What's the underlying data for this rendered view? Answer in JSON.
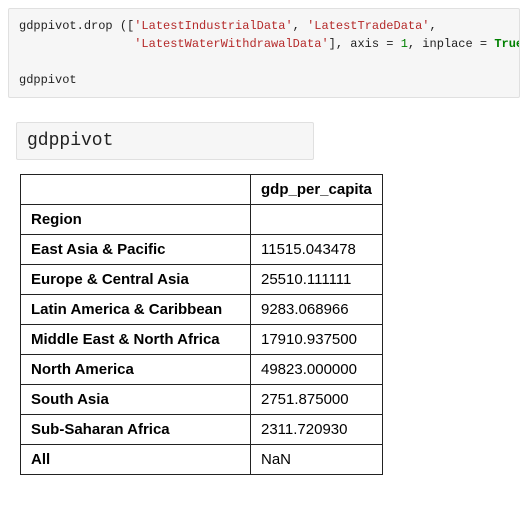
{
  "code_cell": {
    "var": "gdppivot",
    "method": "drop",
    "args_str1": "'LatestIndustrialData'",
    "args_str2": "'LatestTradeData'",
    "args_str3": "'LatestWaterWithdrawalData'",
    "kw_axis": "axis",
    "axis_val": "1",
    "kw_inplace": "inplace",
    "inplace_val": "True",
    "repr_line": "gdppivot"
  },
  "output_repr": "gdppivot",
  "table": {
    "col_header": "gdp_per_capita",
    "index_name": "Region",
    "rows": [
      {
        "region": "East Asia & Pacific",
        "val": "11515.043478"
      },
      {
        "region": "Europe & Central Asia",
        "val": "25510.111111"
      },
      {
        "region": "Latin America & Caribbean",
        "val": "9283.068966"
      },
      {
        "region": "Middle East & North Africa",
        "val": "17910.937500"
      },
      {
        "region": "North America",
        "val": "49823.000000"
      },
      {
        "region": "South Asia",
        "val": "2751.875000"
      },
      {
        "region": "Sub-Saharan Africa",
        "val": "2311.720930"
      },
      {
        "region": "All",
        "val": "NaN"
      }
    ]
  }
}
